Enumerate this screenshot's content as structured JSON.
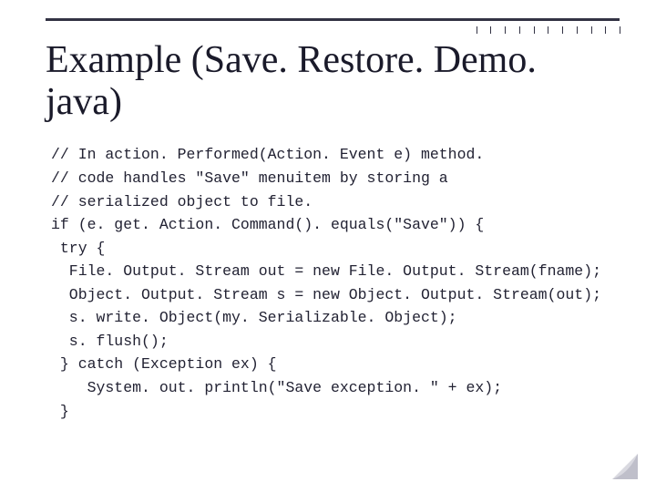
{
  "title": "Example\n(Save. Restore. Demo. java)",
  "code": [
    "// In action. Performed(Action. Event e) method.",
    "// code handles \"Save\" menuitem by storing a",
    "// serialized object to file.",
    "if (e. get. Action. Command(). equals(\"Save\")) {",
    " try {",
    "  File. Output. Stream out = new File. Output. Stream(fname);",
    "  Object. Output. Stream s = new Object. Output. Stream(out);",
    "  s. write. Object(my. Serializable. Object);",
    "  s. flush();",
    " } catch (Exception ex) {",
    "    System. out. println(\"Save exception. \" + ex);",
    " }"
  ]
}
